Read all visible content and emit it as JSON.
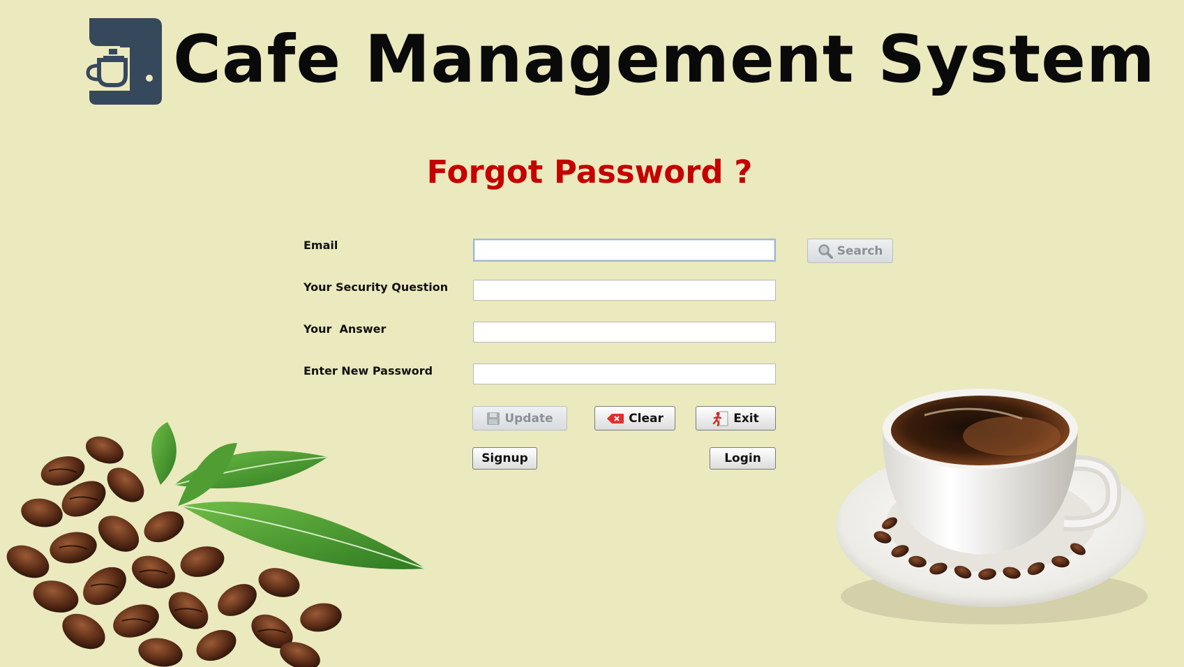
{
  "header": {
    "title": "Cafe Management System",
    "logo_icon": "coffee-machine-icon"
  },
  "page": {
    "heading": "Forgot Password ?"
  },
  "form": {
    "email_label": "Email",
    "email_value": "",
    "security_question_label": "Your Security Question",
    "security_question_value": "",
    "answer_label": "Your  Answer",
    "answer_value": "",
    "new_password_label": "Enter New Password",
    "new_password_value": ""
  },
  "buttons": {
    "search": "Search",
    "update": "Update",
    "clear": "Clear",
    "exit": "Exit",
    "signup": "Signup",
    "login": "Login"
  },
  "colors": {
    "background": "#ebe9be",
    "heading": "#c40000",
    "logo": "#36485c"
  },
  "images": {
    "left": "coffee-beans-with-leaves",
    "right": "coffee-cup-on-saucer"
  }
}
